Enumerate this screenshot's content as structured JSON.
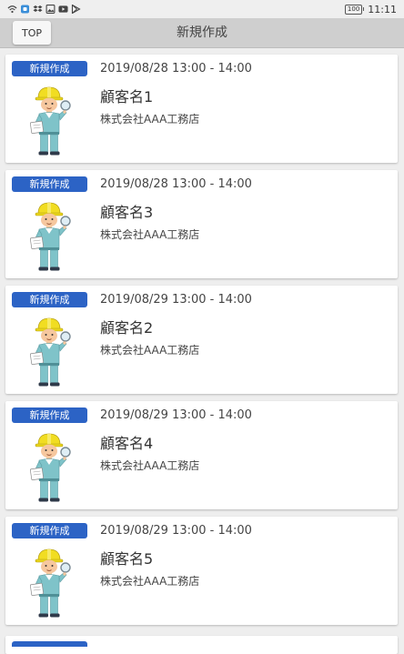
{
  "status_bar": {
    "icons": [
      "wifi-icon",
      "app-icon",
      "dropbox-icon",
      "image-icon",
      "youtube-icon",
      "play-store-icon"
    ],
    "battery": "100",
    "time": "11:11"
  },
  "header": {
    "top_button": "TOP",
    "title": "新規作成"
  },
  "colors": {
    "badge": "#2c63c5",
    "app_bar": "#cfcfcf",
    "background": "#eeeeee"
  },
  "appointments": [
    {
      "badge": "新規作成",
      "time": "2019/08/28 13:00 - 14:00",
      "customer": "顧客名1",
      "company": "株式会社AAA工務店"
    },
    {
      "badge": "新規作成",
      "time": "2019/08/28 13:00 - 14:00",
      "customer": "顧客名3",
      "company": "株式会社AAA工務店"
    },
    {
      "badge": "新規作成",
      "time": "2019/08/29 13:00 - 14:00",
      "customer": "顧客名2",
      "company": "株式会社AAA工務店"
    },
    {
      "badge": "新規作成",
      "time": "2019/08/29 13:00 - 14:00",
      "customer": "顧客名4",
      "company": "株式会社AAA工務店"
    },
    {
      "badge": "新規作成",
      "time": "2019/08/29 13:00 - 14:00",
      "customer": "顧客名5",
      "company": "株式会社AAA工務店"
    }
  ]
}
